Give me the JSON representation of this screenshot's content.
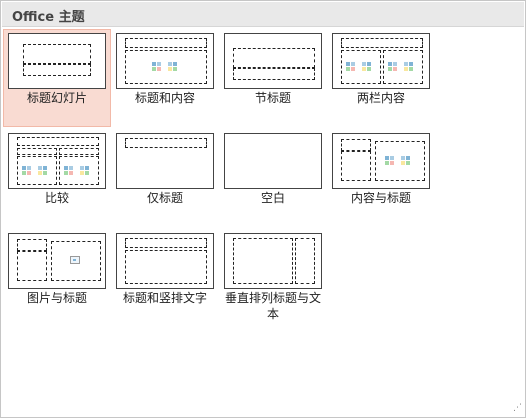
{
  "panel": {
    "title": "Office 主题"
  },
  "layouts": [
    {
      "label": "标题幻灯片",
      "selected": true
    },
    {
      "label": "标题和内容",
      "selected": false
    },
    {
      "label": "节标题",
      "selected": false
    },
    {
      "label": "两栏内容",
      "selected": false
    },
    {
      "label": "比较",
      "selected": false
    },
    {
      "label": "仅标题",
      "selected": false
    },
    {
      "label": "空白",
      "selected": false
    },
    {
      "label": "内容与标题",
      "selected": false
    },
    {
      "label": "图片与标题",
      "selected": false
    },
    {
      "label": "标题和竖排文字",
      "selected": false
    },
    {
      "label": "垂直排列标题与文本",
      "selected": false
    }
  ],
  "grip_glyph": "⋰"
}
